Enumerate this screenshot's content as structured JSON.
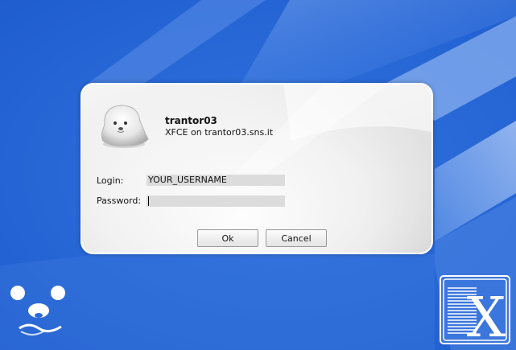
{
  "dialog": {
    "host": "trantor03",
    "session": "XFCE on trantor03.sns.it",
    "login_label": "Login:",
    "login_value": "YOUR_USERNAME",
    "password_label": "Password:",
    "password_value": "",
    "ok_label": "Ok",
    "cancel_label": "Cancel",
    "avatar_icon": "seal-avatar-icon"
  },
  "desktop": {
    "corner_logo_icon": "mouse-face-icon",
    "x_logo_icon": "x-window-logo-icon"
  },
  "colors": {
    "background": "#2a6ad8",
    "dialog_border": "#ffffff",
    "input_bg": "#dcdcdc"
  }
}
